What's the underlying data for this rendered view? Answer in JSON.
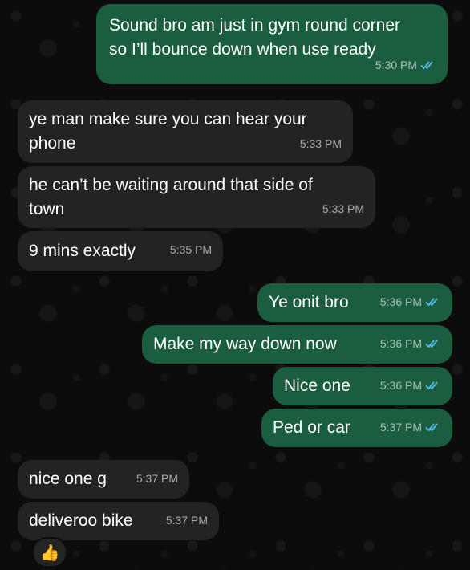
{
  "messages": [
    {
      "dir": "out",
      "text": "Sound bro am just in gym round corner\nso I’ll bounce down when use ready",
      "time": "5:30 PM",
      "read": true
    },
    {
      "dir": "in",
      "text": "ye man make sure you can hear your\nphone",
      "time": "5:33 PM"
    },
    {
      "dir": "in",
      "text": "he can’t be waiting around that side of\ntown",
      "time": "5:33 PM"
    },
    {
      "dir": "in",
      "text": "9 mins exactly",
      "time": "5:35 PM"
    },
    {
      "dir": "out",
      "text": "Ye onit bro",
      "time": "5:36 PM",
      "read": true
    },
    {
      "dir": "out",
      "text": "Make my way down now",
      "time": "5:36 PM",
      "read": true
    },
    {
      "dir": "out",
      "text": "Nice one",
      "time": "5:36 PM",
      "read": true
    },
    {
      "dir": "out",
      "text": "Ped or car",
      "time": "5:37 PM",
      "read": true
    },
    {
      "dir": "in",
      "text": "nice one g",
      "time": "5:37 PM"
    },
    {
      "dir": "in",
      "text": "deliveroo bike",
      "time": "5:37 PM"
    }
  ],
  "reaction": {
    "emoji": "👍",
    "icon": "thumbs-up-icon"
  },
  "colors": {
    "incoming": "#232323",
    "outgoing": "#1b5e3f",
    "read_ticks": "#53bdeb"
  }
}
